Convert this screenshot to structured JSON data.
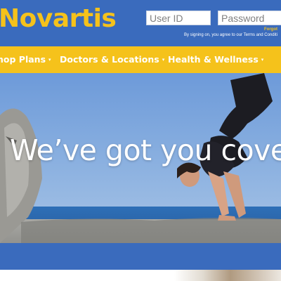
{
  "header": {
    "brand": "Novartis",
    "login": {
      "userid_placeholder": "User ID",
      "password_placeholder": "Password",
      "forgot_text": "Forgot",
      "disclaimer": "By signing on, you agree to our Terms and Conditi"
    }
  },
  "nav": {
    "items": [
      {
        "label": "hop Plans",
        "caret": "▾"
      },
      {
        "label": "Doctors & Locations",
        "caret": "▾"
      },
      {
        "label": "Health & Wellness",
        "caret": "▾"
      }
    ]
  },
  "hero": {
    "title": "We’ve got you covere"
  },
  "colors": {
    "primary_blue": "#3a6bbd",
    "accent_yellow": "#f5c21b"
  }
}
